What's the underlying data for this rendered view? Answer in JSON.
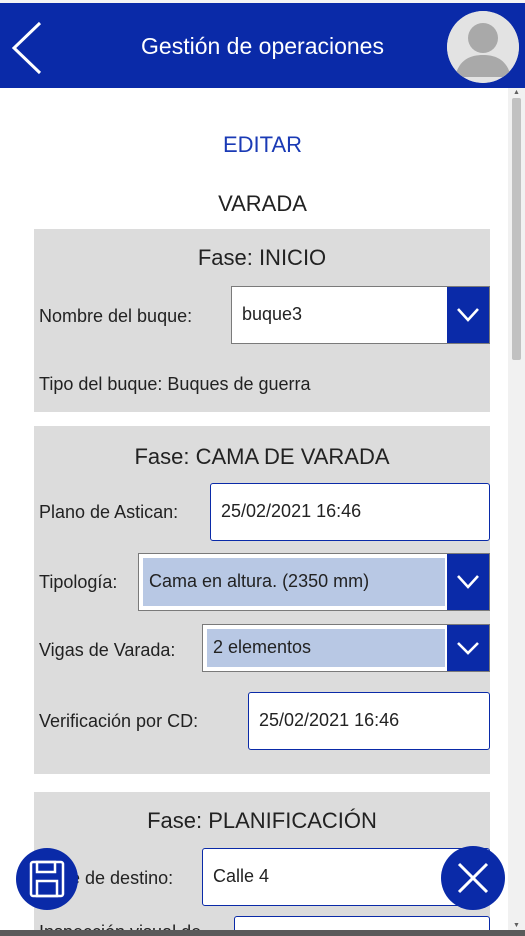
{
  "header": {
    "title": "Gestión de operaciones",
    "back_icon": "chevron-left-icon",
    "avatar_icon": "user-avatar-icon"
  },
  "main": {
    "edit_label": "EDITAR",
    "operation_title": "VARADA"
  },
  "phase_inicio": {
    "title": "Fase: INICIO",
    "ship_name_label": "Nombre del buque:",
    "ship_name_value": "buque3",
    "ship_type_text": "Tipo del buque: Buques de guerra"
  },
  "phase_cama": {
    "title": "Fase: CAMA DE VARADA",
    "plano_label": "Plano de Astican:",
    "plano_value": "25/02/2021 16:46",
    "tipologia_label": "Tipología:",
    "tipologia_value": "Cama en altura. (2350 mm)",
    "vigas_label": "Vigas de Varada:",
    "vigas_value": "2 elementos",
    "verificacion_label": "Verificación por CD:",
    "verificacion_value": "25/02/2021 16:46"
  },
  "phase_planificacion": {
    "title": "Fase: PLANIFICACIÓN",
    "calle_label": "Calle de destino:",
    "calle_value": "Calle 4",
    "inspeccion_label": "Inspección visual de"
  },
  "actions": {
    "save_icon": "floppy-disk-icon",
    "close_icon": "close-icon"
  },
  "colors": {
    "primary": "#0a2aa8",
    "card_bg": "#dcdcdc",
    "select_tint": "#b8c8e4",
    "link": "#1a3ab5"
  }
}
